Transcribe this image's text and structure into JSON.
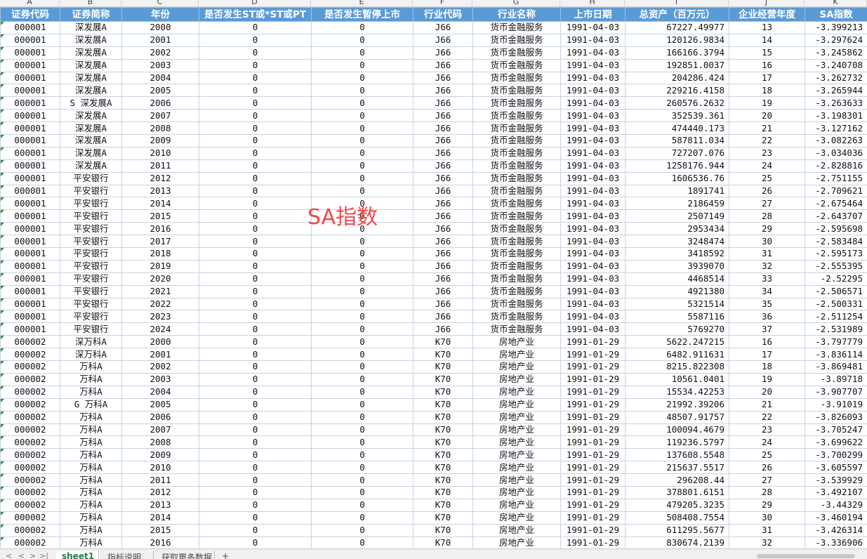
{
  "column_letters": [
    "A",
    "B",
    "C",
    "D",
    "E",
    "F",
    "G",
    "H",
    "I",
    "J",
    "K"
  ],
  "headers": [
    "证券代码",
    "证券简称",
    "年份",
    "是否发生ST或*ST或PT",
    "是否发生暂停上市",
    "行业代码",
    "行业名称",
    "上市日期",
    "总资产（百万元）",
    "企业经营年度",
    "SA指数"
  ],
  "rows": [
    [
      "000001",
      "深发展A",
      "2000",
      "0",
      "0",
      "J66",
      "货币金融服务",
      "1991-04-03",
      "67227.49977",
      "13",
      "-3.399213"
    ],
    [
      "000001",
      "深发展A",
      "2001",
      "0",
      "0",
      "J66",
      "货币金融服务",
      "1991-04-03",
      "120126.9834",
      "14",
      "-3.297624"
    ],
    [
      "000001",
      "深发展A",
      "2002",
      "0",
      "0",
      "J66",
      "货币金融服务",
      "1991-04-03",
      "166166.3794",
      "15",
      "-3.245862"
    ],
    [
      "000001",
      "深发展A",
      "2003",
      "0",
      "0",
      "J66",
      "货币金融服务",
      "1991-04-03",
      "192851.0037",
      "16",
      "-3.240708"
    ],
    [
      "000001",
      "深发展A",
      "2004",
      "0",
      "0",
      "J66",
      "货币金融服务",
      "1991-04-03",
      "204286.424",
      "17",
      "-3.262732"
    ],
    [
      "000001",
      "深发展A",
      "2005",
      "0",
      "0",
      "J66",
      "货币金融服务",
      "1991-04-03",
      "229216.4158",
      "18",
      "-3.265944"
    ],
    [
      "000001",
      "S 深发展A",
      "2006",
      "0",
      "0",
      "J66",
      "货币金融服务",
      "1991-04-03",
      "260576.2632",
      "19",
      "-3.263633"
    ],
    [
      "000001",
      "深发展A",
      "2007",
      "0",
      "0",
      "J66",
      "货币金融服务",
      "1991-04-03",
      "352539.361",
      "20",
      "-3.198301"
    ],
    [
      "000001",
      "深发展A",
      "2008",
      "0",
      "0",
      "J66",
      "货币金融服务",
      "1991-04-03",
      "474440.173",
      "21",
      "-3.127162"
    ],
    [
      "000001",
      "深发展A",
      "2009",
      "0",
      "0",
      "J66",
      "货币金融服务",
      "1991-04-03",
      "587811.034",
      "22",
      "-3.082263"
    ],
    [
      "000001",
      "深发展A",
      "2010",
      "0",
      "0",
      "J66",
      "货币金融服务",
      "1991-04-03",
      "727207.076",
      "23",
      "-3.034036"
    ],
    [
      "000001",
      "深发展A",
      "2011",
      "0",
      "0",
      "J66",
      "货币金融服务",
      "1991-04-03",
      "1258176.944",
      "24",
      "-2.828816"
    ],
    [
      "000001",
      "平安银行",
      "2012",
      "0",
      "0",
      "J66",
      "货币金融服务",
      "1991-04-03",
      "1606536.76",
      "25",
      "-2.751155"
    ],
    [
      "000001",
      "平安银行",
      "2013",
      "0",
      "0",
      "J66",
      "货币金融服务",
      "1991-04-03",
      "1891741",
      "26",
      "-2.709621"
    ],
    [
      "000001",
      "平安银行",
      "2014",
      "0",
      "0",
      "J66",
      "货币金融服务",
      "1991-04-03",
      "2186459",
      "27",
      "-2.675464"
    ],
    [
      "000001",
      "平安银行",
      "2015",
      "0",
      "0",
      "J66",
      "货币金融服务",
      "1991-04-03",
      "2507149",
      "28",
      "-2.643707"
    ],
    [
      "000001",
      "平安银行",
      "2016",
      "0",
      "0",
      "J66",
      "货币金融服务",
      "1991-04-03",
      "2953434",
      "29",
      "-2.595698"
    ],
    [
      "000001",
      "平安银行",
      "2017",
      "0",
      "0",
      "J66",
      "货币金融服务",
      "1991-04-03",
      "3248474",
      "30",
      "-2.583484"
    ],
    [
      "000001",
      "平安银行",
      "2018",
      "0",
      "0",
      "J66",
      "货币金融服务",
      "1991-04-03",
      "3418592",
      "31",
      "-2.595173"
    ],
    [
      "000001",
      "平安银行",
      "2019",
      "0",
      "0",
      "J66",
      "货币金融服务",
      "1991-04-03",
      "3939070",
      "32",
      "-2.555395"
    ],
    [
      "000001",
      "平安银行",
      "2020",
      "0",
      "0",
      "J66",
      "货币金融服务",
      "1991-04-03",
      "4468514",
      "33",
      "-2.52295"
    ],
    [
      "000001",
      "平安银行",
      "2021",
      "0",
      "0",
      "J66",
      "货币金融服务",
      "1991-04-03",
      "4921380",
      "34",
      "-2.506571"
    ],
    [
      "000001",
      "平安银行",
      "2022",
      "0",
      "0",
      "J66",
      "货币金融服务",
      "1991-04-03",
      "5321514",
      "35",
      "-2.500331"
    ],
    [
      "000001",
      "平安银行",
      "2023",
      "0",
      "0",
      "J66",
      "货币金融服务",
      "1991-04-03",
      "5587116",
      "36",
      "-2.511254"
    ],
    [
      "000001",
      "平安银行",
      "2024",
      "0",
      "0",
      "J66",
      "货币金融服务",
      "1991-04-03",
      "5769270",
      "37",
      "-2.531989"
    ],
    [
      "000002",
      "深万科A",
      "2000",
      "0",
      "0",
      "K70",
      "房地产业",
      "1991-01-29",
      "5622.247215",
      "16",
      "-3.797779"
    ],
    [
      "000002",
      "深万科A",
      "2001",
      "0",
      "0",
      "K70",
      "房地产业",
      "1991-01-29",
      "6482.911631",
      "17",
      "-3.836114"
    ],
    [
      "000002",
      "万科A",
      "2002",
      "0",
      "0",
      "K70",
      "房地产业",
      "1991-01-29",
      "8215.822308",
      "18",
      "-3.869481"
    ],
    [
      "000002",
      "万科A",
      "2003",
      "0",
      "0",
      "K70",
      "房地产业",
      "1991-01-29",
      "10561.0401",
      "19",
      "-3.89718"
    ],
    [
      "000002",
      "万科A",
      "2004",
      "0",
      "0",
      "K70",
      "房地产业",
      "1991-01-29",
      "15534.42253",
      "20",
      "-3.907707"
    ],
    [
      "000002",
      "G 万科A",
      "2005",
      "0",
      "0",
      "K70",
      "房地产业",
      "1991-01-29",
      "21992.39206",
      "21",
      "-3.91019"
    ],
    [
      "000002",
      "万科A",
      "2006",
      "0",
      "0",
      "K70",
      "房地产业",
      "1991-01-29",
      "48507.91757",
      "22",
      "-3.826093"
    ],
    [
      "000002",
      "万科A",
      "2007",
      "0",
      "0",
      "K70",
      "房地产业",
      "1991-01-29",
      "100094.4679",
      "23",
      "-3.705247"
    ],
    [
      "000002",
      "万科A",
      "2008",
      "0",
      "0",
      "K70",
      "房地产业",
      "1991-01-29",
      "119236.5797",
      "24",
      "-3.699622"
    ],
    [
      "000002",
      "万科A",
      "2009",
      "0",
      "0",
      "K70",
      "房地产业",
      "1991-01-29",
      "137608.5548",
      "25",
      "-3.700299"
    ],
    [
      "000002",
      "万科A",
      "2010",
      "0",
      "0",
      "K70",
      "房地产业",
      "1991-01-29",
      "215637.5517",
      "26",
      "-3.605597"
    ],
    [
      "000002",
      "万科A",
      "2011",
      "0",
      "0",
      "K70",
      "房地产业",
      "1991-01-29",
      "296208.44",
      "27",
      "-3.539929"
    ],
    [
      "000002",
      "万科A",
      "2012",
      "0",
      "0",
      "K70",
      "房地产业",
      "1991-01-29",
      "378801.6151",
      "28",
      "-3.492107"
    ],
    [
      "000002",
      "万科A",
      "2013",
      "0",
      "0",
      "K70",
      "房地产业",
      "1991-01-29",
      "479205.3235",
      "29",
      "-3.44329"
    ],
    [
      "000002",
      "万科A",
      "2014",
      "0",
      "0",
      "K70",
      "房地产业",
      "1991-01-29",
      "508408.7554",
      "30",
      "-3.460194"
    ],
    [
      "000002",
      "万科A",
      "2015",
      "0",
      "0",
      "K70",
      "房地产业",
      "1991-01-29",
      "611295.5677",
      "31",
      "-3.426314"
    ],
    [
      "000002",
      "万科A",
      "2016",
      "0",
      "0",
      "K70",
      "房地产业",
      "1991-01-29",
      "830674.2139",
      "32",
      "-3.336906"
    ]
  ],
  "watermark": "SA指数",
  "sheet_tabs": [
    "sheet1",
    "指标说明",
    "获取更多数据"
  ],
  "active_tab": "sheet1",
  "add_tab_label": "+",
  "nav_glyphs": [
    "<",
    "<",
    ">",
    ">|"
  ],
  "colors": {
    "header_bg": "#5b9bd5",
    "watermark": "#f04a4a",
    "active_tab": "#1e7f3e"
  }
}
